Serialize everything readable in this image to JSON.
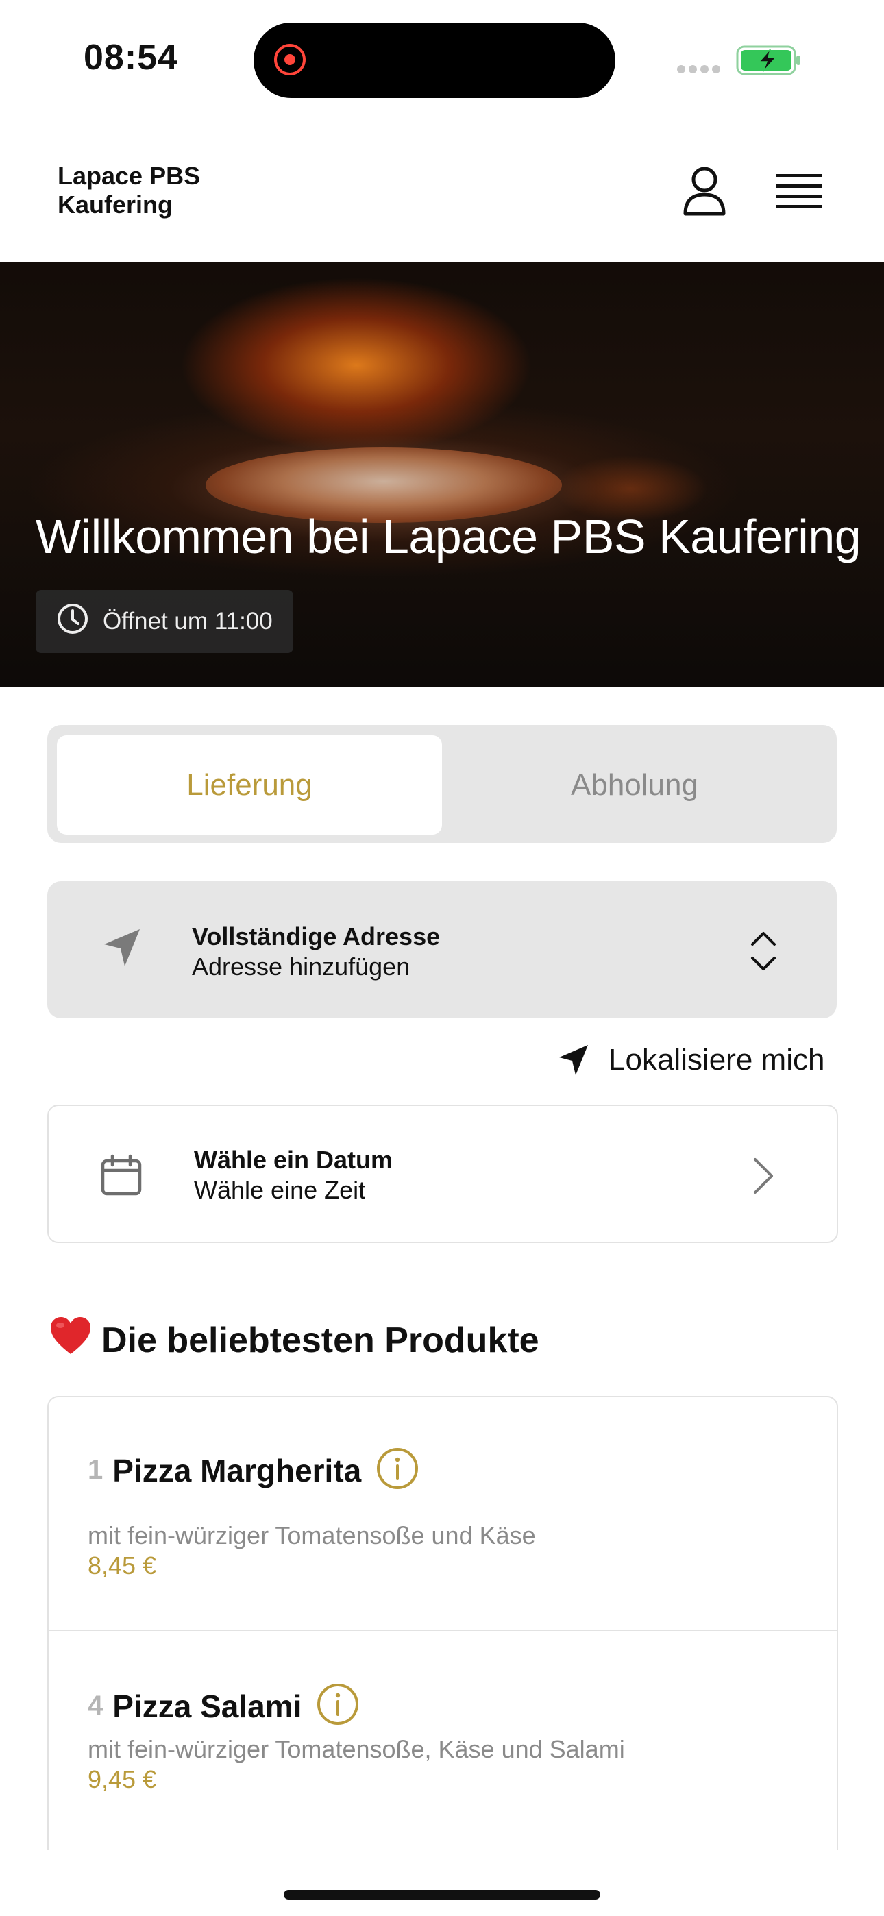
{
  "status_bar": {
    "time": "08:54"
  },
  "header": {
    "brand_line1": "Lapace PBS",
    "brand_line2": "Kaufering"
  },
  "hero": {
    "title": "Willkommen bei Lapace PBS Kaufering",
    "opening": "Öffnet um 11:00"
  },
  "mode_tabs": [
    {
      "label": "Lieferung",
      "active": true
    },
    {
      "label": "Abholung",
      "active": false
    }
  ],
  "address": {
    "title": "Vollständige Adresse",
    "subtitle": "Adresse hinzufügen"
  },
  "locate_label": "Lokalisiere mich",
  "date_picker": {
    "title": "Wähle ein Datum",
    "subtitle": "Wähle eine Zeit"
  },
  "popular": {
    "title": "Die beliebtesten Produkte",
    "items": [
      {
        "number": "1",
        "name": "Pizza Margherita",
        "description": "mit fein-würziger Tomatensoße und Käse",
        "price": "8,45 €"
      },
      {
        "number": "4",
        "name": "Pizza Salami",
        "description": "mit fein-würziger Tomatensoße, Käse und Salami",
        "price": "9,45 €"
      }
    ]
  },
  "colors": {
    "accent": "#b99a3a",
    "card_bg": "#e6e6e6",
    "muted": "#8a8a8a"
  }
}
